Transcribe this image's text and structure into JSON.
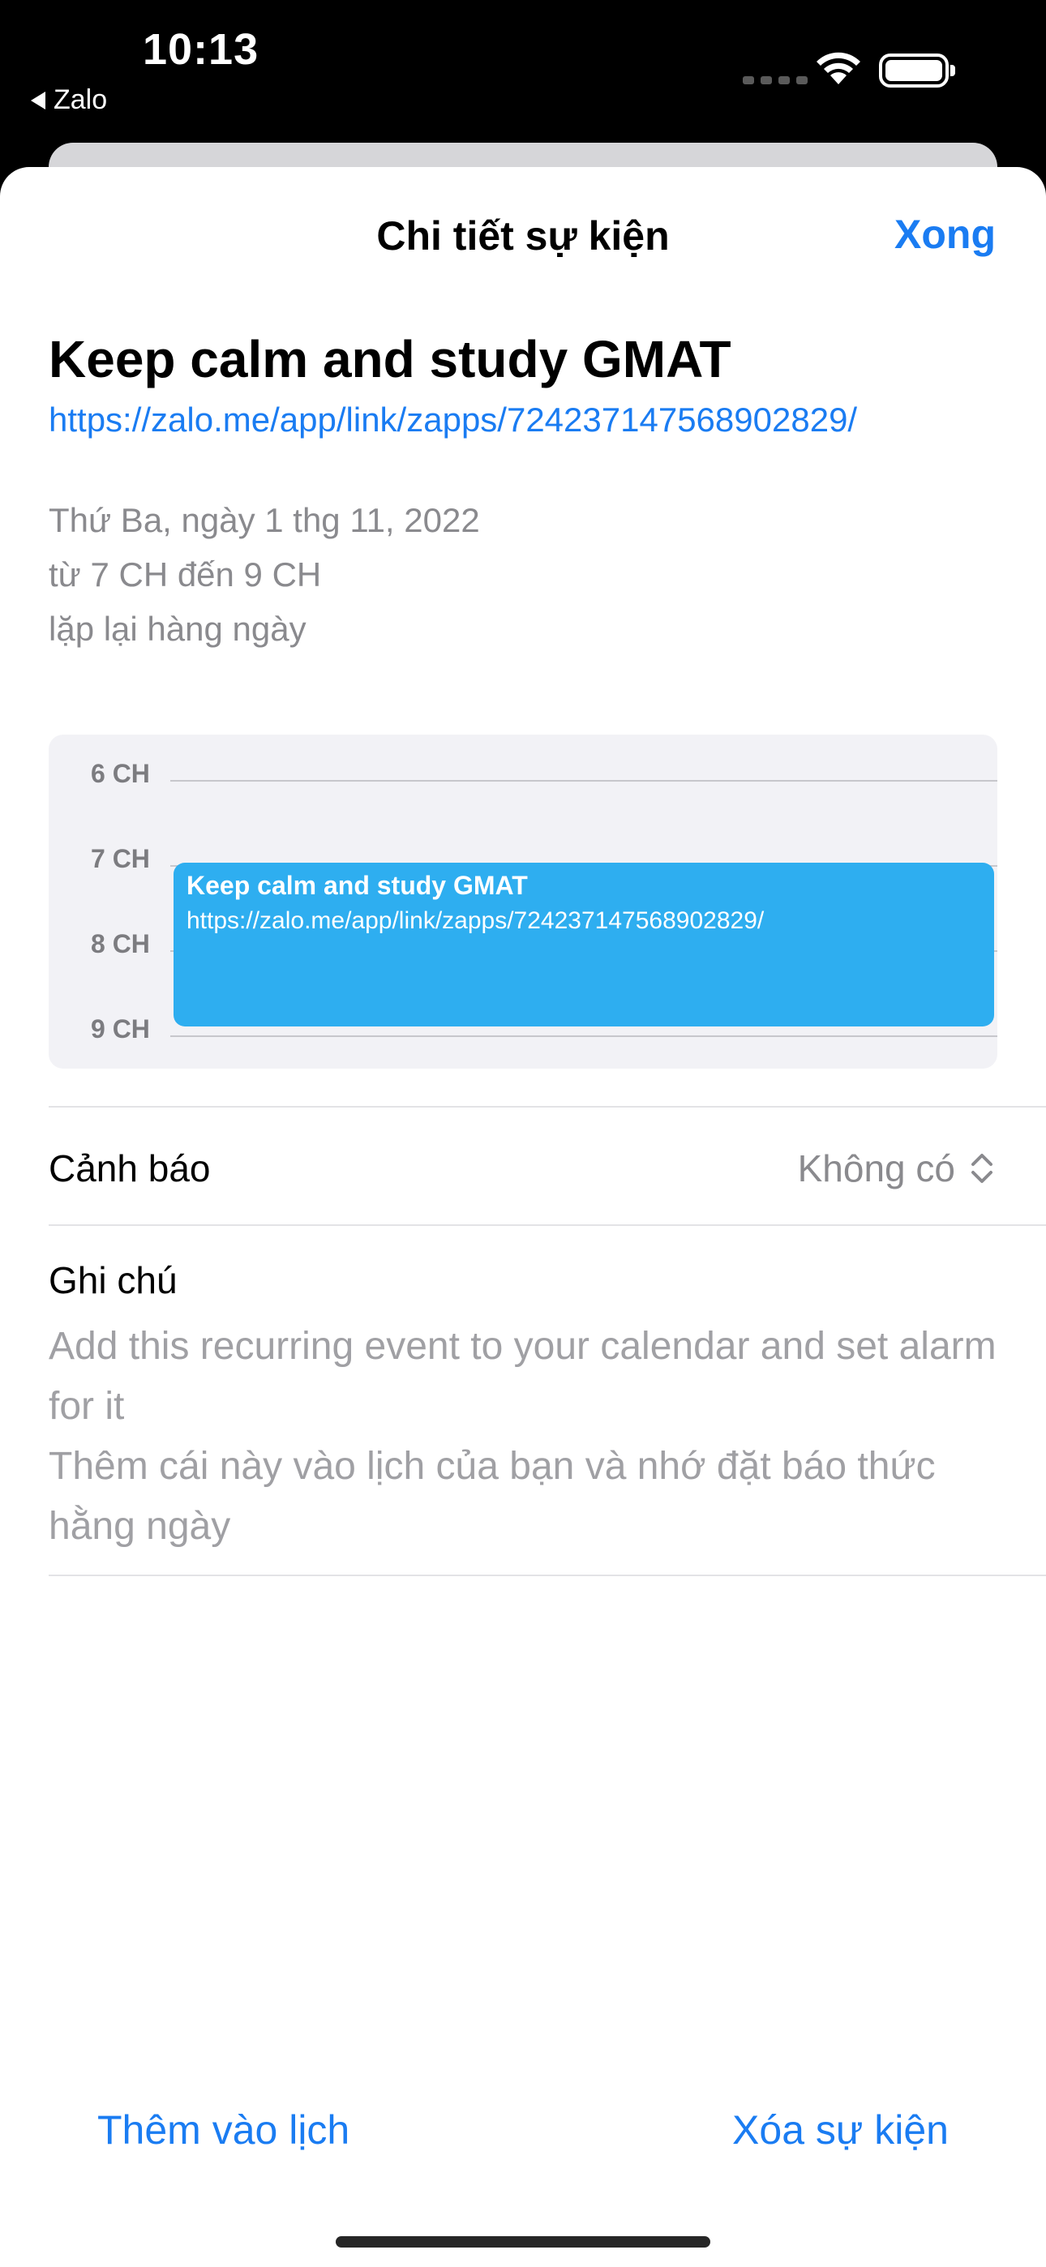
{
  "status_bar": {
    "time": "10:13",
    "back_app": "Zalo",
    "icons": [
      "cellular-signal-icon",
      "wifi-icon",
      "battery-icon"
    ]
  },
  "nav": {
    "title": "Chi tiết sự kiện",
    "done_label": "Xong"
  },
  "event": {
    "title": "Keep calm and study GMAT",
    "url": "https://zalo.me/app/link/zapps/724237147568902829/",
    "date": "Thứ Ba, ngày 1 thg 11, 2022",
    "time_range": "từ 7 CH đến 9 CH",
    "repeat": "lặp lại hàng ngày"
  },
  "day_view": {
    "hours": [
      "6 CH",
      "7 CH",
      "8 CH",
      "9 CH"
    ],
    "block_title": "Keep calm and study GMAT",
    "block_url": "https://zalo.me/app/link/zapps/724237147568902829/",
    "block_color": "#2eaef0"
  },
  "alert": {
    "label": "Cảnh báo",
    "value": "Không có"
  },
  "notes": {
    "label": "Ghi chú",
    "text": "Add this recurring event to your calendar and set alarm for it\nThêm cái này vào lịch của bạn và nhớ đặt báo thức hằng ngày"
  },
  "actions": {
    "add_label": "Thêm vào lịch",
    "delete_label": "Xóa sự kiện"
  },
  "colors": {
    "accent": "#1a7cf2",
    "secondary_text": "#8a8a8e"
  }
}
